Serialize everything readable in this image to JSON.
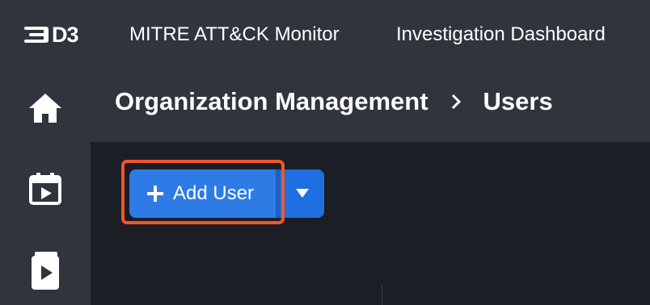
{
  "topbar": {
    "logo_text": "D3",
    "nav": [
      {
        "label": "MITRE ATT&CK Monitor"
      },
      {
        "label": "Investigation Dashboard"
      }
    ]
  },
  "sidebar": {
    "items": [
      {
        "icon": "home-icon"
      },
      {
        "icon": "calendar-play-icon"
      },
      {
        "icon": "playbook-icon"
      }
    ]
  },
  "breadcrumb": {
    "parent": "Organization Management",
    "current": "Users"
  },
  "actions": {
    "add_user_label": "Add User"
  },
  "colors": {
    "topbar": "#30343c",
    "content": "#1b1e25",
    "primary": "#2f7be5",
    "highlight": "#f0572a"
  }
}
